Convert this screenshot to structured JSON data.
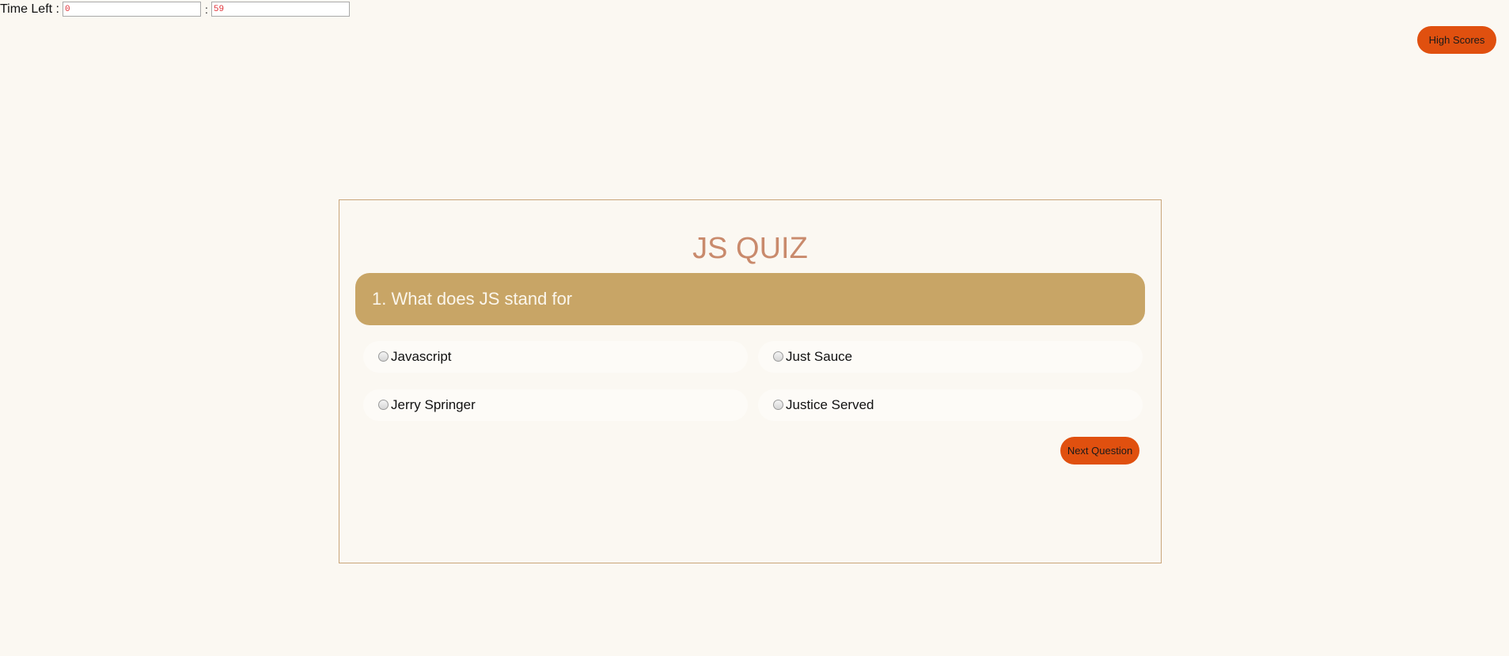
{
  "timer": {
    "label": "Time Left :",
    "minutes": "0",
    "separator": ":",
    "seconds": "59"
  },
  "header": {
    "high_scores_label": "High Scores"
  },
  "quiz": {
    "title": "JS QUIZ",
    "question": "1. What does JS stand for",
    "options": [
      {
        "label": "Javascript"
      },
      {
        "label": "Just Sauce"
      },
      {
        "label": "Jerry Springer"
      },
      {
        "label": "Justice Served"
      }
    ],
    "next_label": "Next Question"
  },
  "colors": {
    "background": "#fbf8f2",
    "accent_button": "#e0500f",
    "question_bar": "#c8a566",
    "title": "#c98a6c",
    "timer_text": "#e0343a"
  }
}
